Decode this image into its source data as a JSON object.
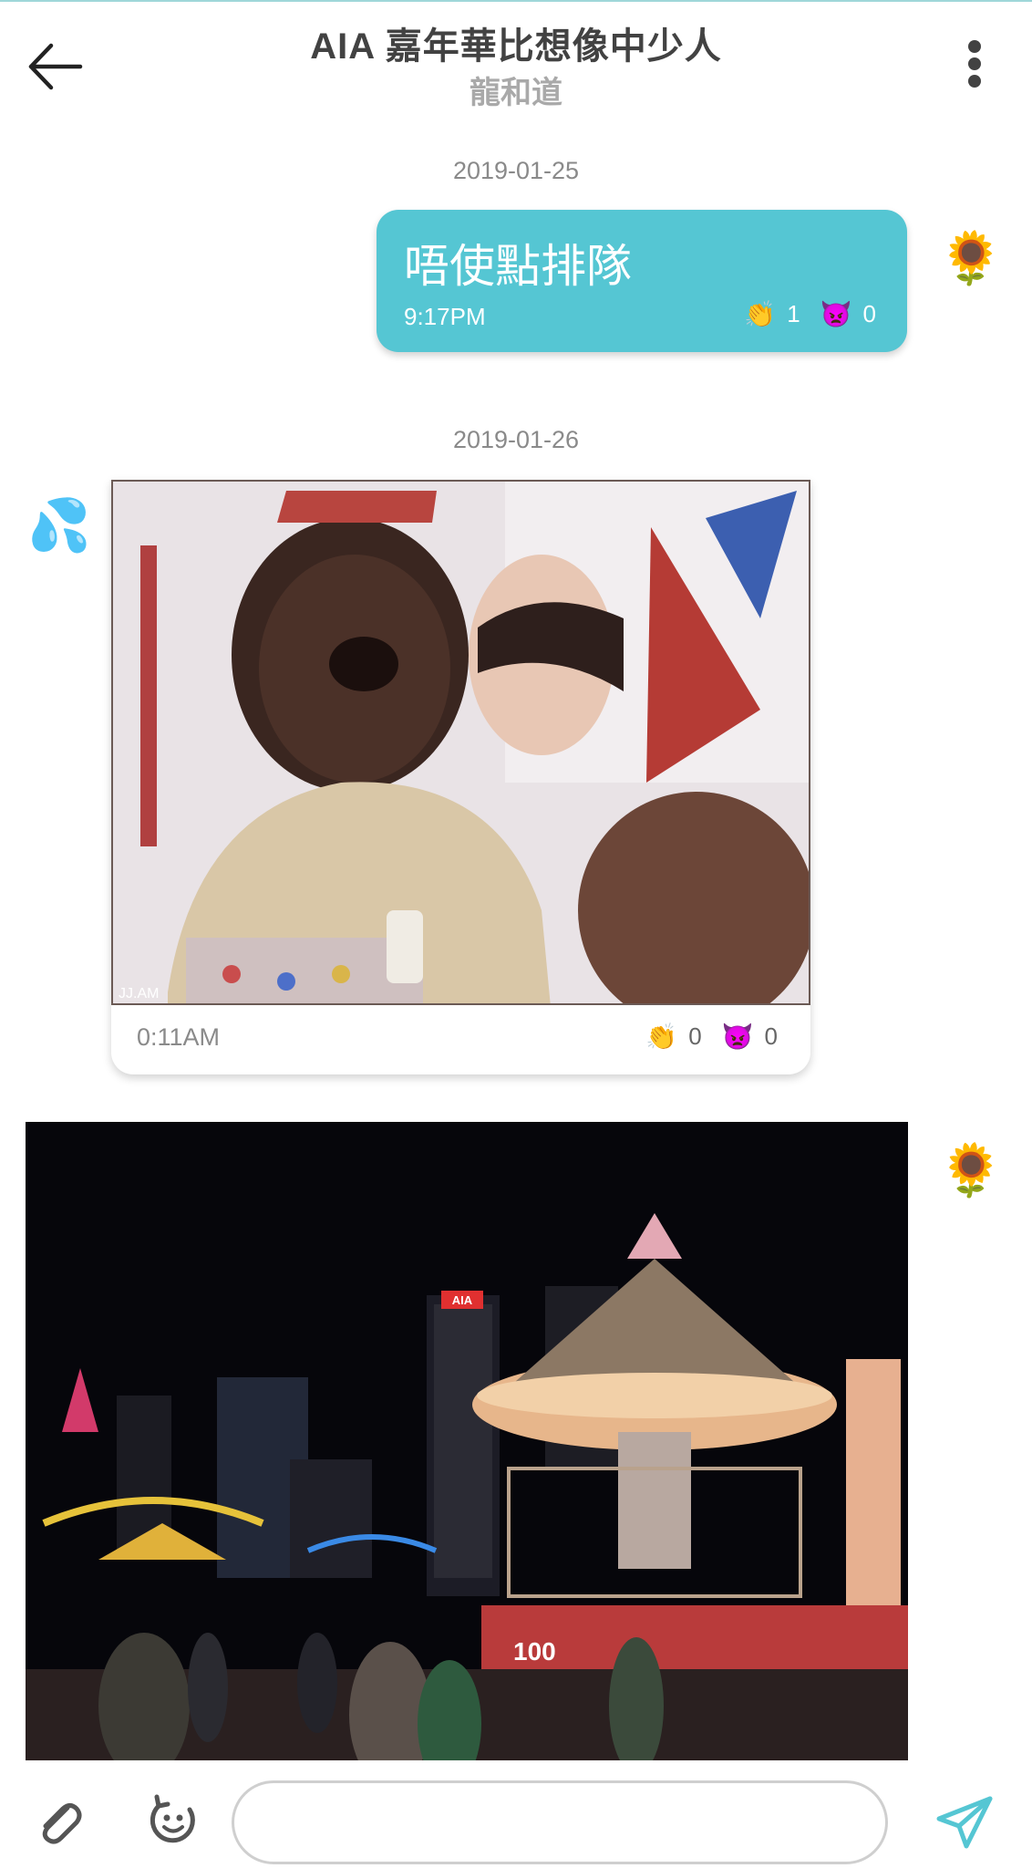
{
  "header": {
    "title": "AIA 嘉年華比想像中少人",
    "subtitle": "龍和道"
  },
  "messages": [
    {
      "date": "2019-01-25",
      "direction": "outgoing",
      "avatar": "🌻",
      "text": "唔使點排隊",
      "time": "9:17PM",
      "reactions": {
        "clap_emoji": "👏",
        "clap": "1",
        "devil_emoji": "👿",
        "devil": "0"
      }
    },
    {
      "date": "2019-01-26",
      "direction": "incoming",
      "avatar": "💦",
      "type": "gif",
      "image_watermark": "JJ.AM",
      "time": "0:11AM",
      "reactions": {
        "clap_emoji": "👏",
        "clap": "0",
        "devil_emoji": "👿",
        "devil": "0"
      }
    },
    {
      "direction": "outgoing",
      "avatar": "🌻",
      "type": "photo",
      "sign_text": "AIA",
      "banner_text": "100"
    }
  ],
  "composer": {
    "placeholder": "",
    "value": ""
  },
  "colors": {
    "accent": "#55c6d3",
    "title": "#424242",
    "subtitle": "#a9a9a9",
    "meta": "#8a8a8a"
  },
  "icons": [
    "arrow-left-icon",
    "more-vertical-icon",
    "paperclip-icon",
    "sticker-icon",
    "send-icon"
  ]
}
